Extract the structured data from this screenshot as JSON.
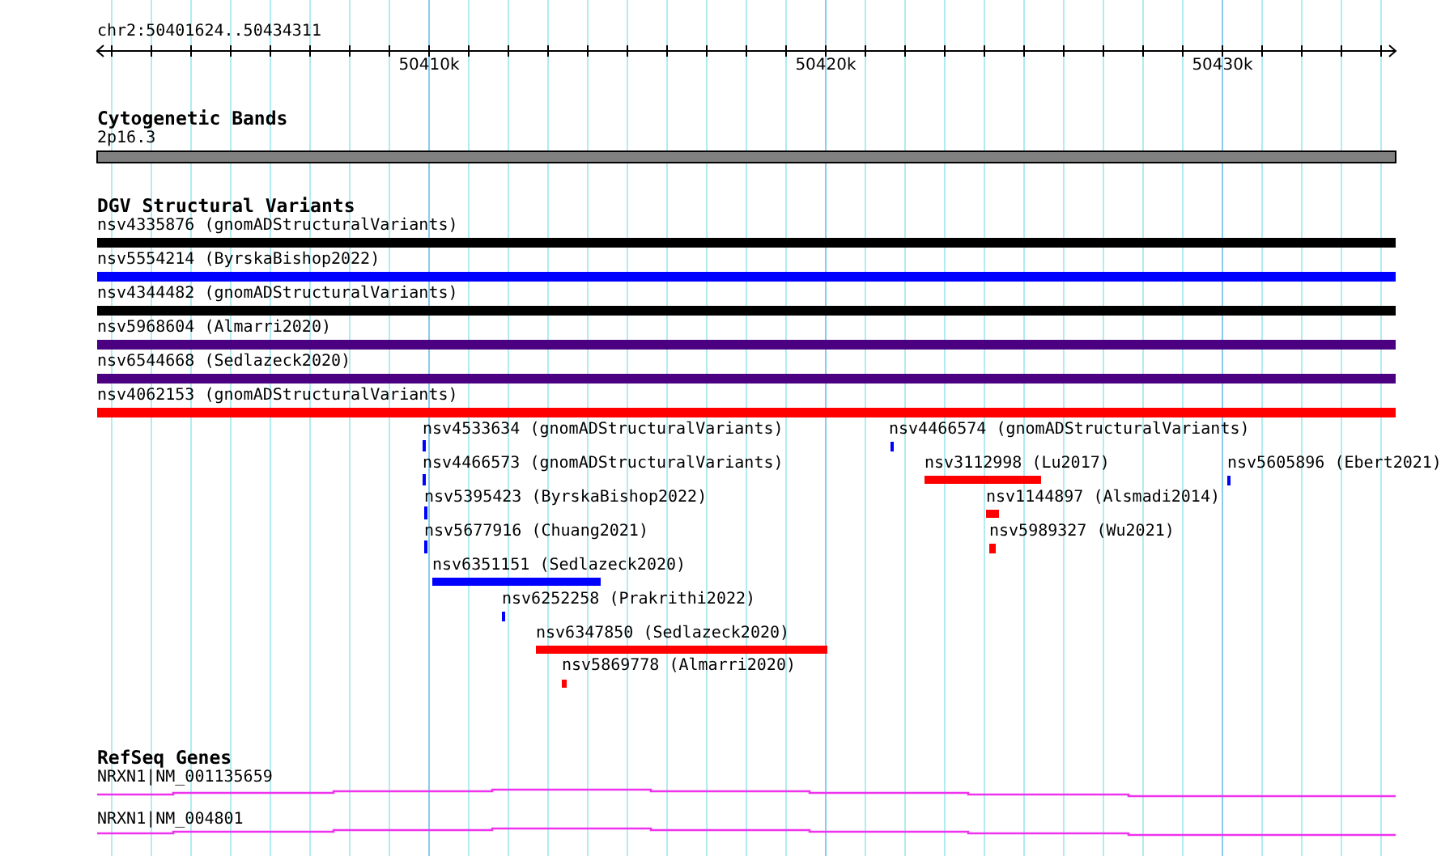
{
  "ruler": {
    "location": "chr2:50401624..50434311",
    "major_labels": [
      "50410k",
      "50420k",
      "50430k"
    ]
  },
  "cytogenetic_bands": {
    "title": "Cytogenetic Bands",
    "band": "2p16.3"
  },
  "dgv_structural_variants": {
    "title": "DGV Structural Variants",
    "features": [
      {
        "label": "nsv4335876 (gnomADStructuralVariants)",
        "color": "#000000"
      },
      {
        "label": "nsv5554214 (ByrskaBishop2022)",
        "color": "#0000ff"
      },
      {
        "label": "nsv4344482 (gnomADStructuralVariants)",
        "color": "#000000"
      },
      {
        "label": "nsv5968604 (Almarri2020)",
        "color": "#4b0082"
      },
      {
        "label": "nsv6544668 (Sedlazeck2020)",
        "color": "#4b0082"
      },
      {
        "label": "nsv4062153 (gnomADStructuralVariants)",
        "color": "#ff0000"
      },
      {
        "label": "nsv4533634 (gnomADStructuralVariants)",
        "color": "#0000ff"
      },
      {
        "label": "nsv4466574 (gnomADStructuralVariants)",
        "color": "#0000ff"
      },
      {
        "label": "nsv4466573 (gnomADStructuralVariants)",
        "color": "#0000ff"
      },
      {
        "label": "nsv3112998 (Lu2017)",
        "color": "#ff0000"
      },
      {
        "label": "nsv5605896 (Ebert2021)",
        "color": "#0000ff"
      },
      {
        "label": "nsv5395423 (ByrskaBishop2022)",
        "color": "#0000ff"
      },
      {
        "label": "nsv1144897 (Alsmadi2014)",
        "color": "#ff0000"
      },
      {
        "label": "nsv5677916 (Chuang2021)",
        "color": "#0000ff"
      },
      {
        "label": "nsv5989327 (Wu2021)",
        "color": "#ff0000"
      },
      {
        "label": "nsv6351151 (Sedlazeck2020)",
        "color": "#0000ff"
      },
      {
        "label": "nsv6252258 (Prakrithi2022)",
        "color": "#0000ff"
      },
      {
        "label": "nsv6347850 (Sedlazeck2020)",
        "color": "#ff0000"
      },
      {
        "label": "nsv5869778 (Almarri2020)",
        "color": "#ff0000"
      }
    ]
  },
  "refseq_genes": {
    "title": "RefSeq Genes",
    "transcripts": [
      "NRXN1|NM_001135659",
      "NRXN1|NM_004801"
    ]
  }
}
